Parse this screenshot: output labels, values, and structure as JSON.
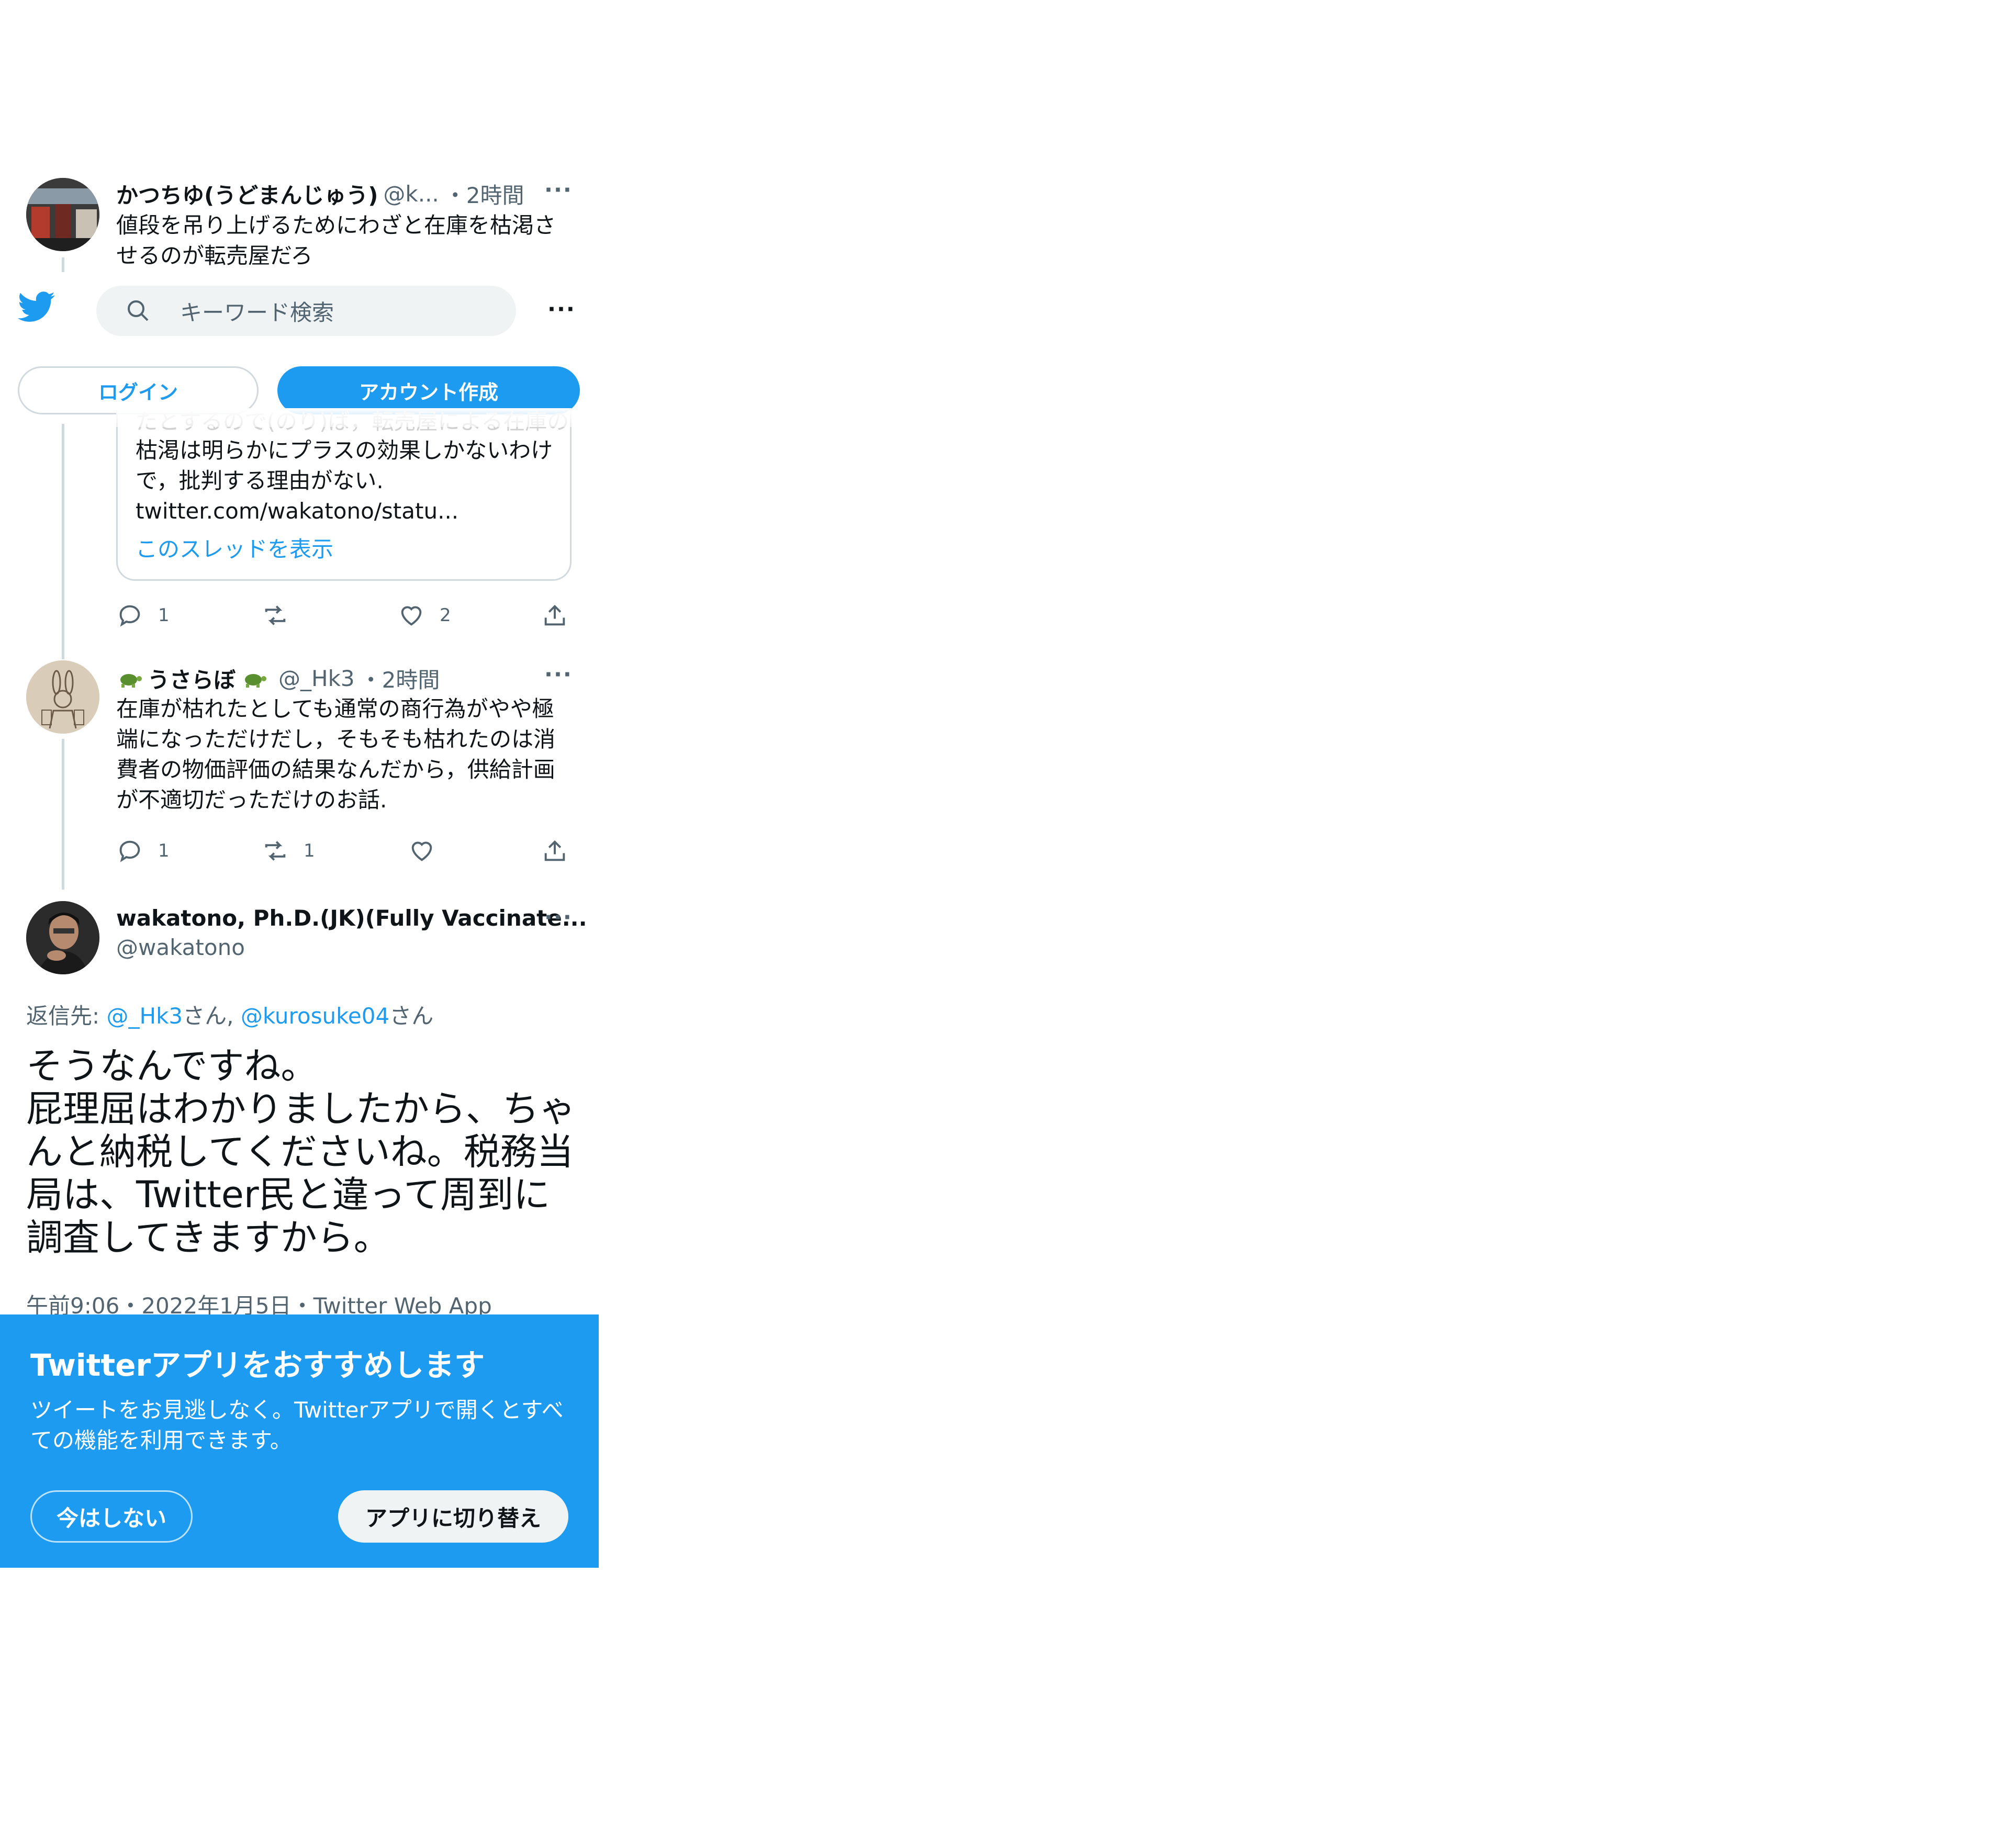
{
  "tweets": [
    {
      "name": "かつちゆ(うどまんじゅう)",
      "handle": "@k...",
      "time": "・2時間",
      "text": "値段を吊り上げるためにわざと在庫を枯渇させるのが転売屋だろ"
    },
    {
      "quote_partial_line": "たとするので(のり)ば，転売屋による在庫の",
      "quote_text": "枯渇は明らかにプラスの効果しかないわけで，批判する理由がない.",
      "quote_link": "twitter.com/wakatono/statu...",
      "show_thread": "このスレッドを表示",
      "reply_count": "1",
      "like_count": "2"
    },
    {
      "name": "うさらぼ",
      "handle": "@_Hk3",
      "time": "・2時間",
      "text": "在庫が枯れたとしても通常の商行為がやや極端になっただけだし，そもそも枯れたのは消費者の物価評価の結果なんだから，供給計画が不適切だっただけのお話.",
      "reply_count": "1",
      "retweet_count": "1"
    },
    {
      "name": "wakatono, Ph.D.(JK)(Fully Vaccinate...",
      "handle": "@wakatono",
      "reply_to_prefix": "返信先: ",
      "reply_to_user1": "@_Hk3",
      "reply_to_san1": "さん,",
      "reply_to_user2": "@kurosuke04",
      "reply_to_san2": "さん",
      "text": "そうなんですね。\n屁理屈はわかりましたから、ちゃんと納税してくださいね。税務当局は、Twitter民と違って周到に調査してきますから。",
      "timestamp": "午前9:06・2022年1月5日・Twitter Web App"
    }
  ],
  "header": {
    "logo_icon": "twitter-bird-icon",
    "search_placeholder": "キーワード検索",
    "login_label": "ログイン",
    "signup_label": "アカウント作成"
  },
  "banner": {
    "title": "Twitterアプリをおすすめします",
    "body": "ツイートをお見逃しなく。Twitterアプリで開くとすべての機能を利用できます。",
    "not_now_label": "今はしない",
    "switch_label": "アプリに切り替え"
  },
  "colors": {
    "accent": "#1d9bf0",
    "banner_bg": "#1d9bf0",
    "secondary_text": "#536471"
  }
}
